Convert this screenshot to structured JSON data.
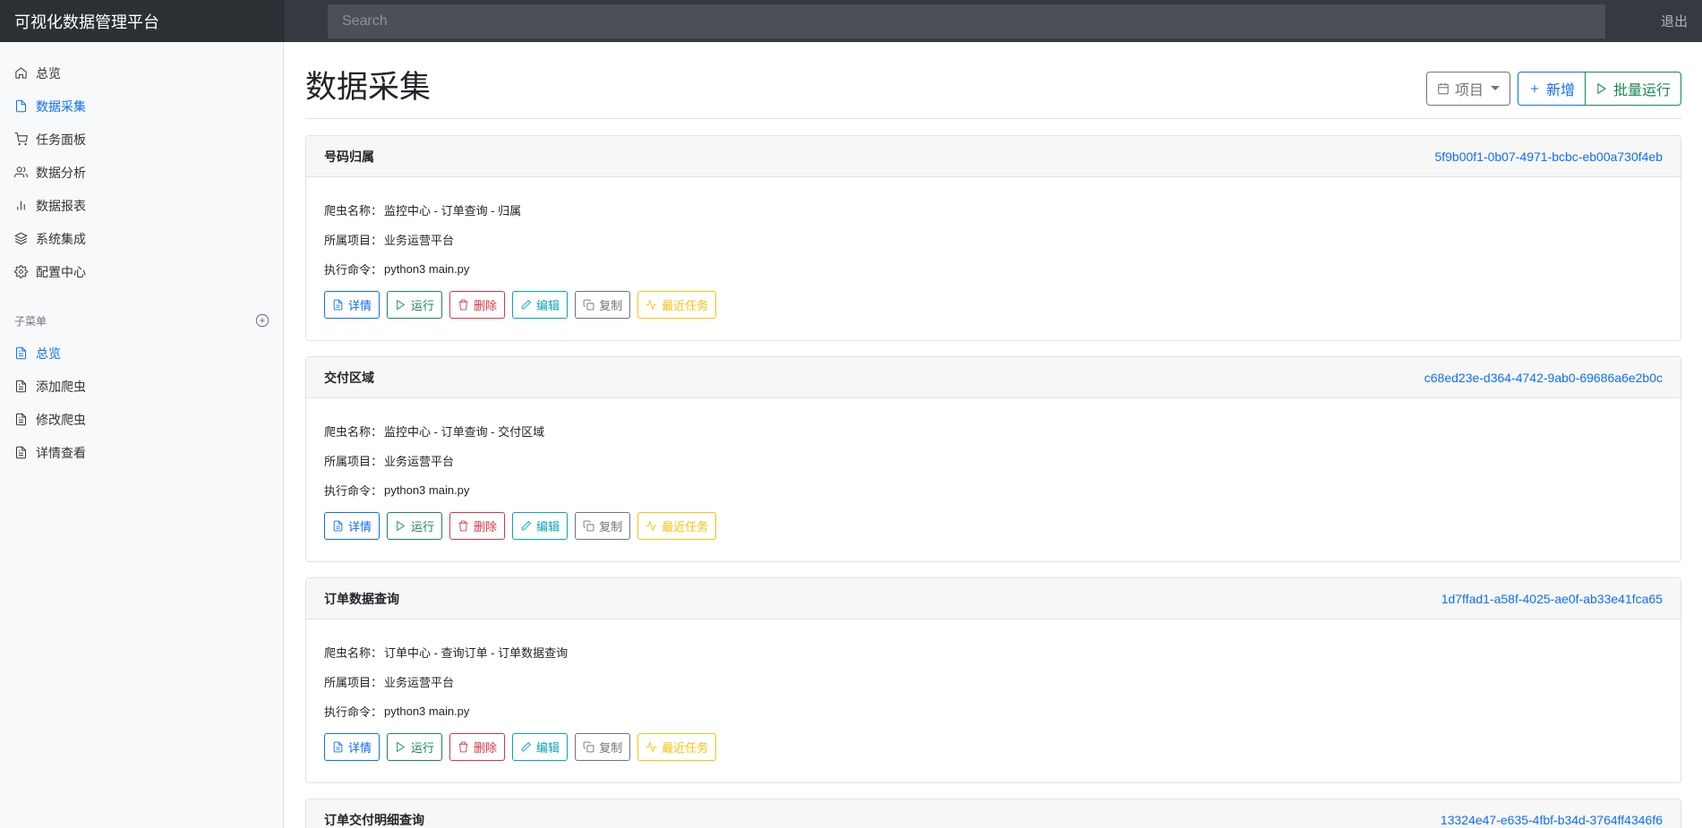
{
  "navbar": {
    "brand": "可视化数据管理平台",
    "search_placeholder": "Search",
    "signout": "退出"
  },
  "sidebar": {
    "items": [
      {
        "label": "总览",
        "icon": "home-icon",
        "active": false
      },
      {
        "label": "数据采集",
        "icon": "file-icon",
        "active": true
      },
      {
        "label": "任务面板",
        "icon": "shopping-cart-icon",
        "active": false
      },
      {
        "label": "数据分析",
        "icon": "users-icon",
        "active": false
      },
      {
        "label": "数据报表",
        "icon": "bar-chart-icon",
        "active": false
      },
      {
        "label": "系统集成",
        "icon": "layers-icon",
        "active": false
      },
      {
        "label": "配置中心",
        "icon": "settings-icon",
        "active": false
      }
    ],
    "sub_heading": "子菜单",
    "sub_items": [
      {
        "label": "总览",
        "icon": "file-text-icon",
        "active": true
      },
      {
        "label": "添加爬虫",
        "icon": "file-text-icon",
        "active": false
      },
      {
        "label": "修改爬虫",
        "icon": "file-text-icon",
        "active": false
      },
      {
        "label": "详情查看",
        "icon": "file-text-icon",
        "active": false
      }
    ]
  },
  "main": {
    "title": "数据采集",
    "toolbar": {
      "project_label": "项目",
      "add_label": "新增",
      "batch_run_label": "批量运行"
    },
    "field_labels": {
      "name": "爬虫名称：",
      "project": "所属项目：",
      "command": "执行命令："
    },
    "action_labels": {
      "detail": "详情",
      "run": "运行",
      "delete": "删除",
      "edit": "编辑",
      "copy": "复制",
      "recent": "最近任务"
    },
    "cards": [
      {
        "title": "号码归属",
        "id": "5f9b00f1-0b07-4971-bcbc-eb00a730f4eb",
        "name": "监控中心 - 订单查询 - 归属",
        "project": "业务运营平台",
        "command": "python3 main.py"
      },
      {
        "title": "交付区域",
        "id": "c68ed23e-d364-4742-9ab0-69686a6e2b0c",
        "name": "监控中心 - 订单查询 - 交付区域",
        "project": "业务运营平台",
        "command": "python3 main.py"
      },
      {
        "title": "订单数据查询",
        "id": "1d7ffad1-a58f-4025-ae0f-ab33e41fca65",
        "name": "订单中心 - 查询订单 - 订单数据查询",
        "project": "业务运营平台",
        "command": "python3 main.py"
      },
      {
        "title": "订单交付明细查询",
        "id": "13324e47-e635-4fbf-b34d-3764ff4346f6"
      }
    ]
  },
  "colors": {
    "primary": "#0d6efd",
    "success": "#198754",
    "danger": "#dc3545",
    "info": "#0aa2c0",
    "secondary": "#6c757d",
    "warning": "#ffc107",
    "navbar": "#343a40"
  }
}
